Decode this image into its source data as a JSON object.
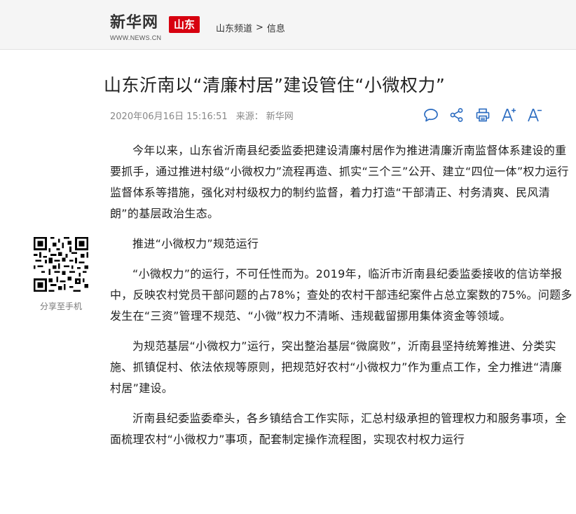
{
  "header": {
    "logo_main": "新华网",
    "logo_region": "山东",
    "logo_url": "WWW.NEWS.CN",
    "breadcrumb": {
      "channel": "山东频道",
      "separator": ">",
      "section": "信息"
    }
  },
  "article": {
    "title": "山东沂南以“清廉村居”建设管住“小微权力”",
    "datetime": "2020年06月16日 15:16:51",
    "source_label": "来源：",
    "source": "新华网",
    "paragraphs": [
      "今年以来，山东省沂南县纪委监委把建设清廉村居作为推进清廉沂南监督体系建设的重要抓手，通过推进村级“小微权力”流程再造、抓实“三个三”公开、建立“四位一体”权力运行监督体系等措施，强化对村级权力的制约监督，着力打造“干部清正、村务清爽、民风清朗”的基层政治生态。",
      "推进“小微权力”规范运行",
      "“小微权力”的运行，不可任性而为。2019年，临沂市沂南县纪委监委接收的信访举报中，反映农村党员干部问题的占78%；查处的农村干部违纪案件占总立案数的75%。问题多发生在“三资”管理不规范、“小微”权力不清晰、违规截留挪用集体资金等领域。",
      "为规范基层“小微权力”运行，突出整治基层“微腐败”，沂南县坚持统筹推进、分类实施、抓镇促村、依法依规等原则，把规范好农村“小微权力”作为重点工作，全力推进“清廉村居”建设。",
      "沂南县纪委监委牵头，各乡镇结合工作实际，汇总村级承担的管理权力和服务事项，全面梳理农村“小微权力”事项，配套制定操作流程图，实现农村权力运行"
    ]
  },
  "tools": [
    "comment-icon",
    "share-icon",
    "print-icon",
    "font-increase-icon",
    "font-decrease-icon"
  ],
  "sidebar": {
    "share_label": "分享至手机"
  },
  "colors": {
    "brand_red": "#d7000f",
    "tool_blue": "#2a6bc0",
    "meta_gray": "#888888"
  }
}
